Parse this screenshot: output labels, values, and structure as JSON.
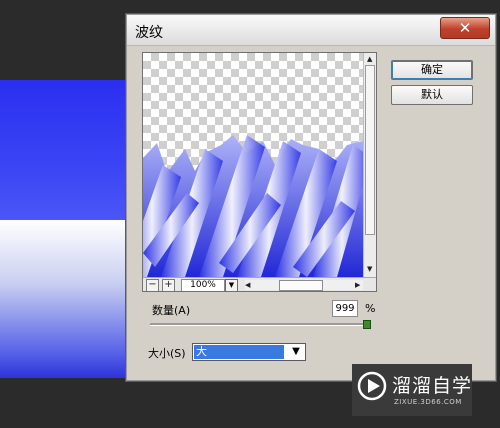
{
  "dialog": {
    "title": "波纹",
    "close_label": "✕",
    "ok_label": "确定",
    "default_label": "默认",
    "amount_label": "数量(A)",
    "amount_value": "999",
    "amount_unit": "%",
    "amount_slider_fraction": 1.0,
    "size_label": "大小(S)",
    "size_value": "大",
    "zoom_value": "100%",
    "zoom_out_label": "−",
    "zoom_in_label": "+"
  },
  "watermark": {
    "brand": "溜溜自学",
    "url": "ZIXUE.3D66.COM"
  },
  "colors": {
    "accent_blue": "#3a79e0",
    "close_red": "#c0412b",
    "preview_blue": "#2c33e6"
  }
}
